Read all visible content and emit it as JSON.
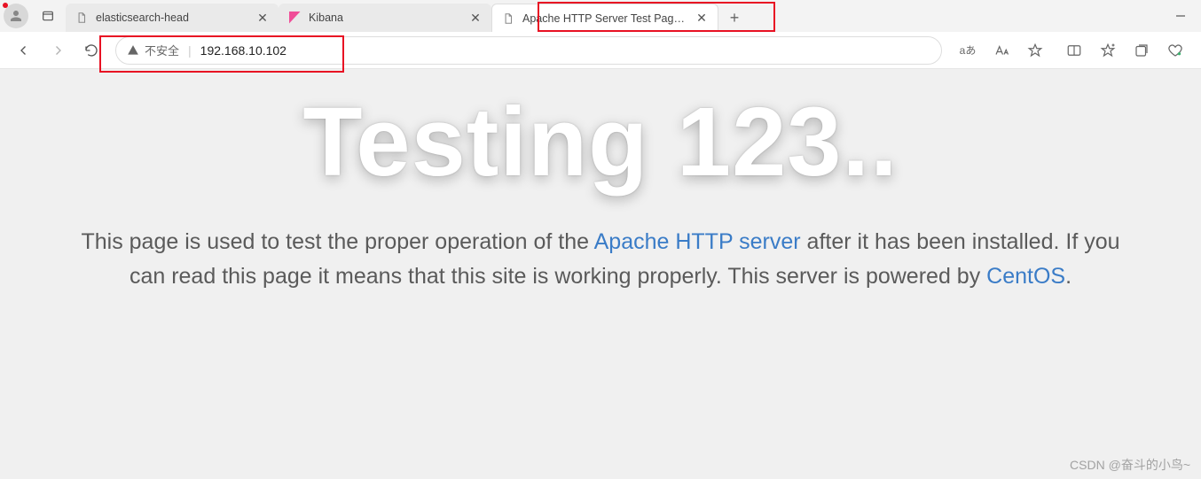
{
  "titlebar": {
    "tabs": [
      {
        "label": "elasticsearch-head",
        "favicon": "page"
      },
      {
        "label": "Kibana",
        "favicon": "kibana"
      },
      {
        "label": "Apache HTTP Server Test Page p",
        "favicon": "page",
        "active": true
      }
    ]
  },
  "toolbar": {
    "security_label": "不安全",
    "url": "192.168.10.102",
    "lang_indicator": "aあ"
  },
  "page": {
    "hero": "Testing 123..",
    "desc_1": "This page is used to test the proper operation of the ",
    "link_apache": "Apache HTTP server",
    "desc_2": " after it has been installed. If you can read this page it means that this site is working properly. This server is powered by ",
    "link_centos": "CentOS",
    "desc_3": "."
  },
  "watermark": "CSDN @奋斗的小鸟~"
}
